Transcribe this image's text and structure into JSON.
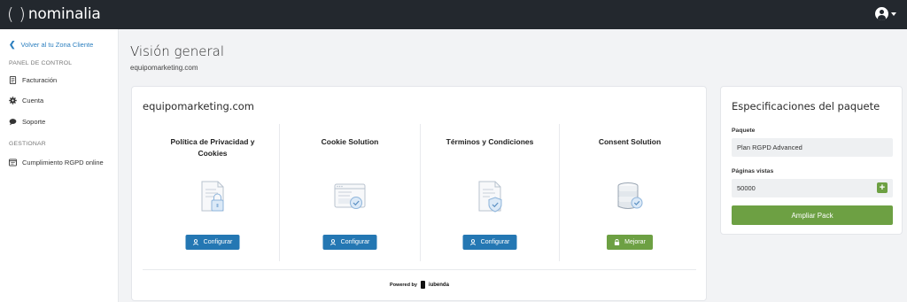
{
  "header": {
    "brand_open": "(",
    "brand_close": ")",
    "brand_name": "nominalia",
    "avatar_icon": "user-circle-icon",
    "caret_icon": "caret-down-icon"
  },
  "sidebar": {
    "back_label": "Volver al tu Zona Cliente",
    "section_control": "PANEL DE CONTROL",
    "items_control": [
      {
        "label": "Facturación",
        "icon": "invoice-icon"
      },
      {
        "label": "Cuenta",
        "icon": "gear-icon"
      },
      {
        "label": "Soporte",
        "icon": "chat-bubble-icon"
      }
    ],
    "section_manage": "GESTIONAR",
    "items_manage": [
      {
        "label": "Cumplimiento RGPD online",
        "icon": "window-icon"
      }
    ]
  },
  "main": {
    "title": "Visión general",
    "subtitle": "equipomarketing.com",
    "card_title": "equipomarketing.com",
    "products": [
      {
        "title": "Política de Privacidad y Cookies",
        "button": "Configurar",
        "icon": "document-lock-icon",
        "button_icon": "user-gear-icon"
      },
      {
        "title": "Cookie Solution",
        "button": "Configurar",
        "icon": "browser-check-icon",
        "button_icon": "user-gear-icon"
      },
      {
        "title": "Términos y Condiciones",
        "button": "Configurar",
        "icon": "document-shield-icon",
        "button_icon": "user-gear-icon"
      },
      {
        "title": "Consent Solution",
        "button": "Mejorar",
        "icon": "database-check-icon",
        "button_icon": "lock-icon"
      }
    ],
    "powered_by": "Powered by",
    "powered_brand": "iubenda"
  },
  "package": {
    "title": "Especificaciones del paquete",
    "package_label": "Paquete",
    "package_value": "Plan RGPD Advanced",
    "views_label": "Páginas vistas",
    "views_value": "50000",
    "plus_label": "+",
    "upgrade_button": "Ampliar Pack"
  },
  "colors": {
    "topbar": "#23282e",
    "link": "#2c7fbf",
    "primary_button": "#2477b3",
    "success_button": "#6da043"
  }
}
